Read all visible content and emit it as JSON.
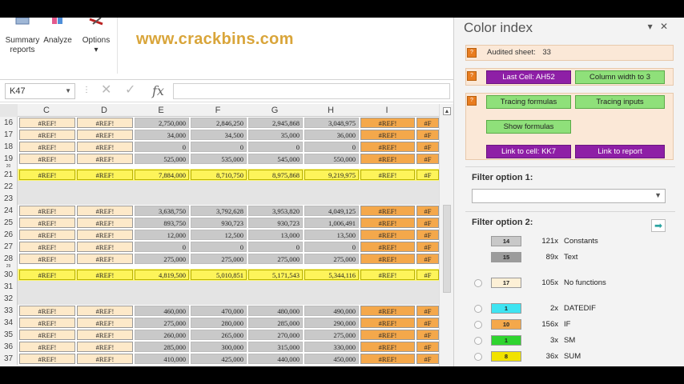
{
  "ribbon": {
    "summary_label": "Summary reports",
    "analyze_label": "Analyze",
    "options_label": "Options",
    "options_caret": "▾"
  },
  "watermark": "www.crackbins.com",
  "formula_bar": {
    "name_box": "K47",
    "cancel_glyph": "✕",
    "enter_glyph": "✓",
    "fx_glyph": "fx",
    "formula": ""
  },
  "grid": {
    "columns": [
      "C",
      "D",
      "E",
      "F",
      "G",
      "H",
      "I",
      ""
    ],
    "rows": [
      {
        "n": "16",
        "kind": "normal",
        "c": "#REF!",
        "d": "#REF!",
        "e": "2,750,000",
        "f": "2,846,250",
        "g": "2,945,868",
        "h": "3,048,975",
        "i": "#REF!",
        "j": "#F"
      },
      {
        "n": "17",
        "kind": "normal",
        "c": "#REF!",
        "d": "#REF!",
        "e": "34,000",
        "f": "34,500",
        "g": "35,000",
        "h": "36,000",
        "i": "#REF!",
        "j": "#F"
      },
      {
        "n": "18",
        "kind": "normal",
        "c": "#REF!",
        "d": "#REF!",
        "e": "0",
        "f": "0",
        "g": "0",
        "h": "0",
        "i": "#REF!",
        "j": "#F"
      },
      {
        "n": "19",
        "kind": "normal",
        "c": "#REF!",
        "d": "#REF!",
        "e": "525,000",
        "f": "535,000",
        "g": "545,000",
        "h": "550,000",
        "i": "#REF!",
        "j": "#F"
      },
      {
        "n": "20",
        "kind": "thin"
      },
      {
        "n": "21",
        "kind": "yellow",
        "c": "#REF!",
        "d": "#REF!",
        "e": "7,884,000",
        "f": "8,710,750",
        "g": "8,975,868",
        "h": "9,219,975",
        "i": "#REF!",
        "j": "#F"
      },
      {
        "n": "22",
        "kind": "gap"
      },
      {
        "n": "23",
        "kind": "gap"
      },
      {
        "n": "24",
        "kind": "normal",
        "c": "#REF!",
        "d": "#REF!",
        "e": "3,638,750",
        "f": "3,792,628",
        "g": "3,953,820",
        "h": "4,049,125",
        "i": "#REF!",
        "j": "#F"
      },
      {
        "n": "25",
        "kind": "normal",
        "c": "#REF!",
        "d": "#REF!",
        "e": "893,750",
        "f": "930,723",
        "g": "930,723",
        "h": "1,006,491",
        "i": "#REF!",
        "j": "#F"
      },
      {
        "n": "26",
        "kind": "normal",
        "c": "#REF!",
        "d": "#REF!",
        "e": "12,000",
        "f": "12,500",
        "g": "13,000",
        "h": "13,500",
        "i": "#REF!",
        "j": "#F"
      },
      {
        "n": "27",
        "kind": "normal",
        "c": "#REF!",
        "d": "#REF!",
        "e": "0",
        "f": "0",
        "g": "0",
        "h": "0",
        "i": "#REF!",
        "j": "#F"
      },
      {
        "n": "28",
        "kind": "normal",
        "c": "#REF!",
        "d": "#REF!",
        "e": "275,000",
        "f": "275,000",
        "g": "275,000",
        "h": "275,000",
        "i": "#REF!",
        "j": "#F"
      },
      {
        "n": "29",
        "kind": "thin"
      },
      {
        "n": "30",
        "kind": "yellow",
        "c": "#REF!",
        "d": "#REF!",
        "e": "4,819,500",
        "f": "5,010,851",
        "g": "5,171,543",
        "h": "5,344,116",
        "i": "#REF!",
        "j": "#F"
      },
      {
        "n": "31",
        "kind": "gap"
      },
      {
        "n": "32",
        "kind": "gap"
      },
      {
        "n": "33",
        "kind": "normal",
        "c": "#REF!",
        "d": "#REF!",
        "e": "460,000",
        "f": "470,000",
        "g": "480,000",
        "h": "490,000",
        "i": "#REF!",
        "j": "#F"
      },
      {
        "n": "34",
        "kind": "normal",
        "c": "#REF!",
        "d": "#REF!",
        "e": "275,000",
        "f": "280,000",
        "g": "285,000",
        "h": "290,000",
        "i": "#REF!",
        "j": "#F"
      },
      {
        "n": "35",
        "kind": "normal",
        "c": "#REF!",
        "d": "#REF!",
        "e": "260,000",
        "f": "265,000",
        "g": "270,000",
        "h": "275,000",
        "i": "#REF!",
        "j": "#F"
      },
      {
        "n": "36",
        "kind": "normal",
        "c": "#REF!",
        "d": "#REF!",
        "e": "285,000",
        "f": "300,000",
        "g": "315,000",
        "h": "330,000",
        "i": "#REF!",
        "j": "#F"
      },
      {
        "n": "37",
        "kind": "normal",
        "c": "#REF!",
        "d": "#REF!",
        "e": "410,000",
        "f": "425,000",
        "g": "440,000",
        "h": "450,000",
        "i": "#REF!",
        "j": "#F"
      }
    ]
  },
  "pane": {
    "title": "Color index",
    "menu_glyph": "▾",
    "close_glyph": "✕",
    "audited_label": "Audited sheet:",
    "audited_value": "33",
    "badge": "?",
    "last_cell": "Last Cell: AH52",
    "column_width": "Column width to 3",
    "tracing_formulas": "Tracing formulas",
    "tracing_inputs": "Tracing inputs",
    "show_formulas": "Show formulas",
    "link_to_cell": "Link to cell: KK7",
    "link_to_report": "Link to report",
    "filter1_label": "Filter option 1:",
    "filter2_label": "Filter option 2:",
    "arrow_glyph": "➡",
    "legend": [
      {
        "swatch": "14",
        "color": "#c8c8c8",
        "count": "121x",
        "name": "Constants",
        "radio": false
      },
      {
        "swatch": "15",
        "color": "#9c9c9c",
        "count": "89x",
        "name": "Text",
        "radio": false
      },
      {
        "swatch": "17",
        "color": "#fdf0d6",
        "count": "105x",
        "name": "No functions",
        "radio": true
      },
      {
        "swatch": "1",
        "color": "#3ee4f2",
        "count": "2x",
        "name": "DATEDIF",
        "radio": true
      },
      {
        "swatch": "10",
        "color": "#f4a84b",
        "count": "156x",
        "name": "IF",
        "radio": true
      },
      {
        "swatch": "1",
        "color": "#2fd42f",
        "count": "3x",
        "name": "SM",
        "radio": true
      },
      {
        "swatch": "8",
        "color": "#f1e200",
        "count": "36x",
        "name": "SUM",
        "radio": true
      }
    ]
  }
}
